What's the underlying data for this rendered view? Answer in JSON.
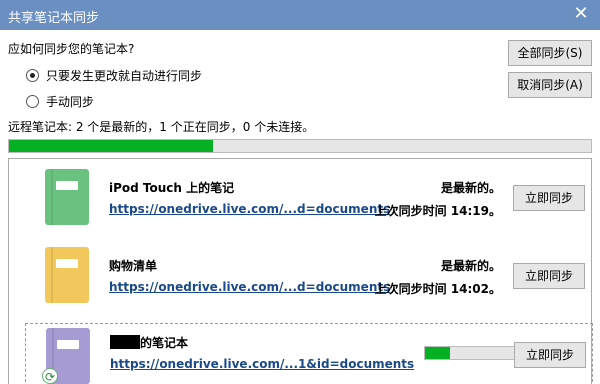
{
  "window": {
    "title": "共享笔记本同步",
    "close_glyph": "✕"
  },
  "sync_prompt": {
    "question": "应如何同步您的笔记本?",
    "options": [
      {
        "label": "只要发生更改就自动进行同步",
        "checked": true
      },
      {
        "label": "手动同步",
        "checked": false
      }
    ]
  },
  "buttons": {
    "sync_all": "全部同步(S)",
    "cancel_sync": "取消同步(A)"
  },
  "status": {
    "text": "远程笔记本: 2 个是最新的，1 个正在同步，0 个未连接。",
    "progress_fraction": 0.35
  },
  "notebooks": [
    {
      "name": "iPod Touch 上的笔记",
      "url": "https://onedrive.live.com/...d=documents",
      "state": "是最新的。",
      "last_sync": "上次同步时间 14:19。",
      "sync_button": "立即同步",
      "color": "#69c27f",
      "icon": "notebook-icon"
    },
    {
      "name": "购物清单",
      "url": "https://onedrive.live.com/...d=documents",
      "state": "是最新的。",
      "last_sync": "上次同步时间 14:02。",
      "sync_button": "立即同步",
      "color": "#f2c75c",
      "icon": "notebook-icon"
    },
    {
      "name": "的笔记本",
      "url": "https://onedrive.live.com/...1&id=documents",
      "sync_progress_fraction": 0.25,
      "sync_button": "立即同步",
      "color": "#a79bd3",
      "icon": "notebook-icon",
      "badge_icon": "sync-icon",
      "badge_glyph": "⟳"
    }
  ]
}
